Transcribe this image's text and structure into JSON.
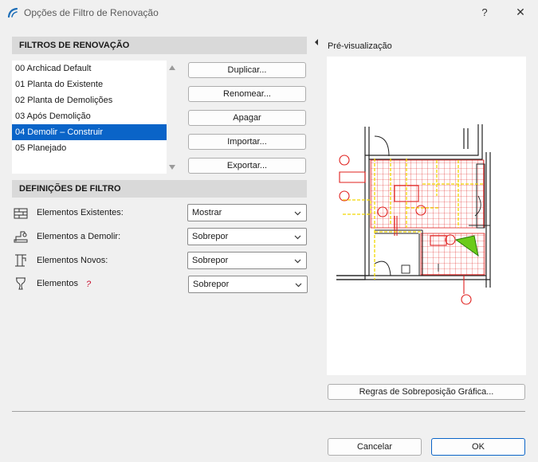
{
  "window": {
    "title": "Opções de Filtro de Renovação",
    "help_glyph": "?",
    "close_glyph": "✕",
    "app_icon": "archicad-icon"
  },
  "filters": {
    "header": "FILTROS DE RENOVAÇÃO",
    "items": [
      "00 Archicad Default",
      "01 Planta do Existente",
      "02 Planta de Demolições",
      "03 Após Demolição",
      "04 Demolir – Construir",
      "05 Planejado"
    ],
    "selected_index": 4,
    "buttons": {
      "duplicate": "Duplicar...",
      "rename": "Renomear...",
      "delete": "Apagar",
      "import": "Importar...",
      "export": "Exportar..."
    }
  },
  "definitions": {
    "header": "DEFINIÇÕES DE FILTRO",
    "rows": [
      {
        "label": "Elementos Existentes:",
        "value": "Mostrar",
        "icon": "existing-elements-icon"
      },
      {
        "label": "Elementos a Demolir:",
        "value": "Sobrepor",
        "icon": "demolish-elements-icon"
      },
      {
        "label": "Elementos Novos:",
        "value": "Sobrepor",
        "icon": "new-elements-icon"
      },
      {
        "label": "Elementos",
        "value": "Sobrepor",
        "icon": "vase-icon",
        "suffix": "?"
      }
    ]
  },
  "preview": {
    "label": "Pré-visualização",
    "overrides_button": "Regras de Sobreposição Gráfica..."
  },
  "footer": {
    "cancel": "Cancelar",
    "ok": "OK"
  },
  "colors": {
    "selection": "#0a64c8",
    "header_bg": "#d9d9d9",
    "demolish": "#e0201e",
    "new": "#f2d800",
    "accent_green": "#6ccb1a"
  }
}
